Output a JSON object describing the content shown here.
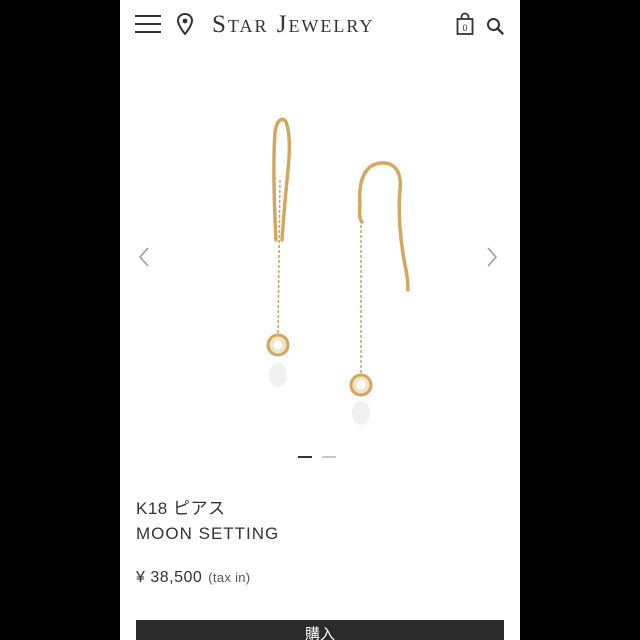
{
  "header": {
    "brand": "Star Jewelry",
    "menu_icon": "hamburger-menu-icon",
    "location_icon": "map-pin-icon",
    "bag_icon": "shopping-bag-icon",
    "bag_count": "0",
    "search_icon": "search-icon"
  },
  "gallery": {
    "prev_icon": "chevron-left-icon",
    "next_icon": "chevron-right-icon",
    "slide_count": 2,
    "active_slide": 1
  },
  "product": {
    "category": "K18 ピアス",
    "name": "MOON SETTING",
    "price": "¥ 38,500",
    "tax_note": "(tax in)"
  },
  "actions": {
    "buy_label": "購入"
  },
  "colors": {
    "gold": "#d4a761",
    "text": "#333333",
    "button": "#2b2b2b"
  }
}
